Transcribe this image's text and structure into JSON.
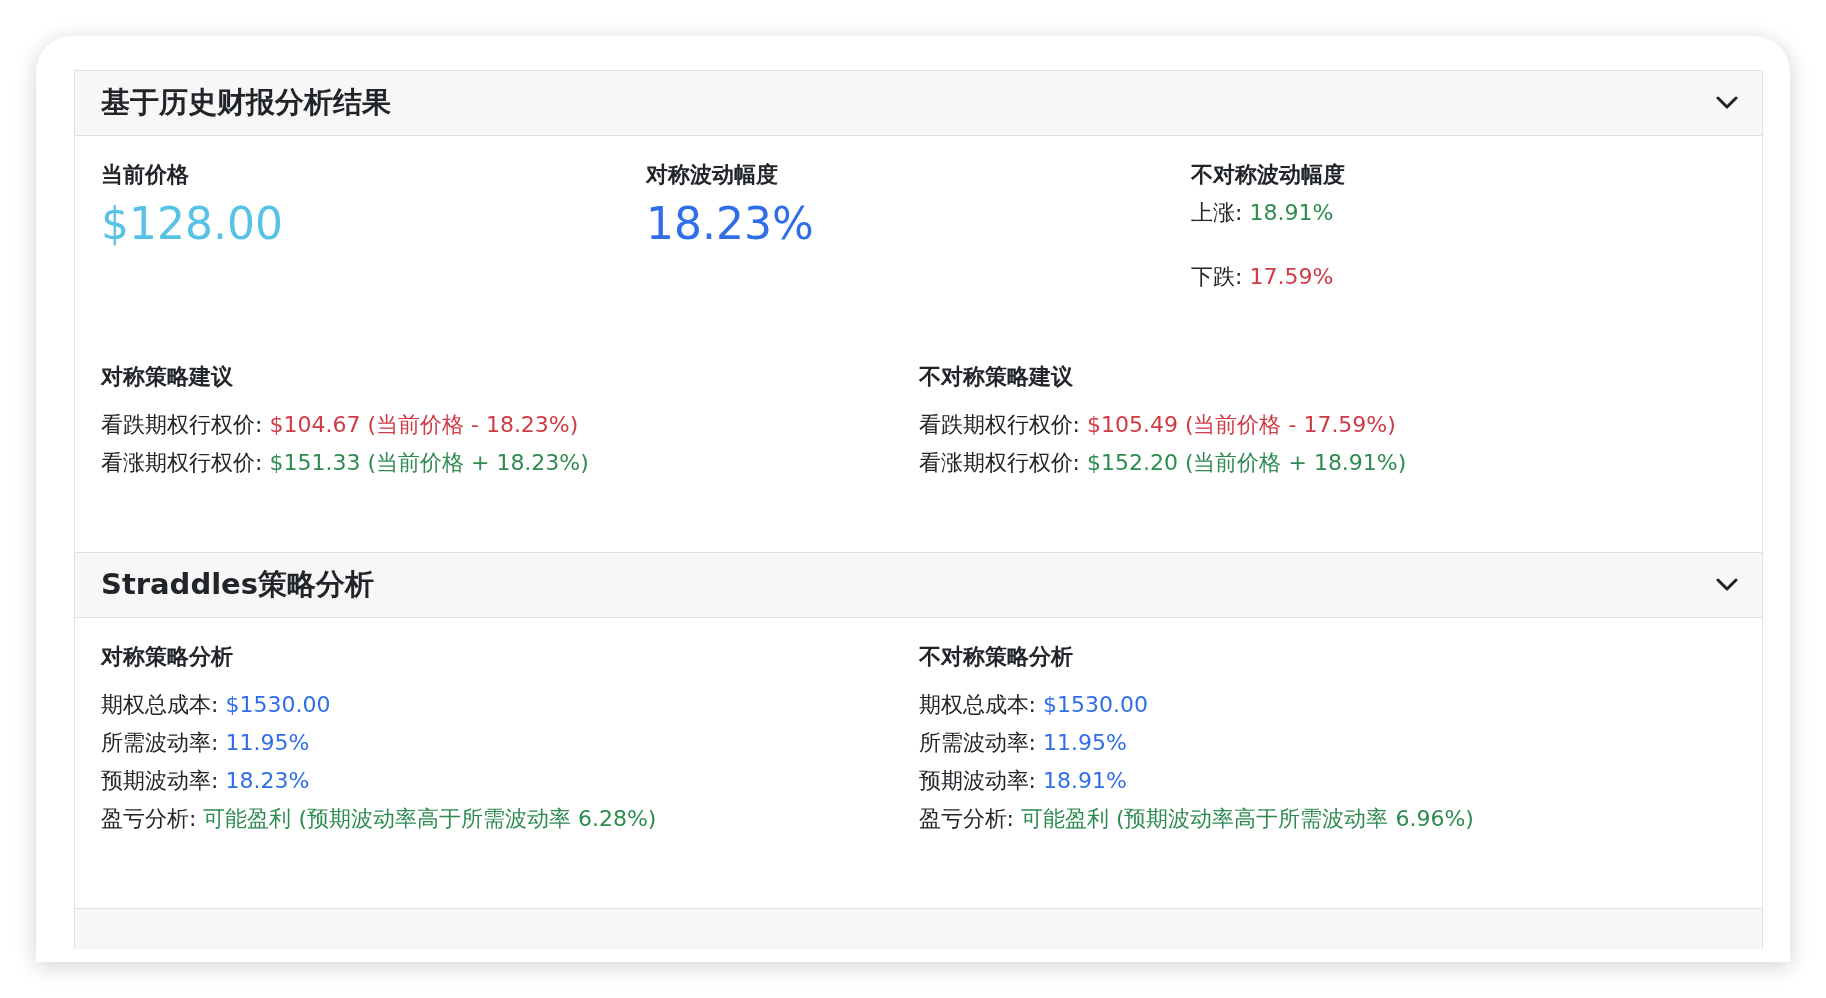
{
  "sections": [
    {
      "title": "基于历史财报分析结果",
      "expanded": true,
      "metrics": [
        {
          "label": "当前价格",
          "kind": "price",
          "value": "$128.00"
        },
        {
          "label": "对称波动幅度",
          "kind": "percent",
          "value": "18.23%"
        },
        {
          "label": "不对称波动幅度",
          "kind": "split",
          "lines": [
            {
              "label": "上涨:",
              "value": "18.91%",
              "kind": "up"
            },
            {
              "label": "下跌:",
              "value": "17.59%",
              "kind": "down"
            }
          ]
        }
      ],
      "columns": [
        {
          "heading": "对称策略建议",
          "lines": [
            {
              "label": "看跌期权行权价:",
              "value": "$104.67 (当前价格 - 18.23%)",
              "kind": "down"
            },
            {
              "label": "看涨期权行权价:",
              "value": "$151.33 (当前价格 + 18.23%)",
              "kind": "up"
            }
          ]
        },
        {
          "heading": "不对称策略建议",
          "lines": [
            {
              "label": "看跌期权行权价:",
              "value": "$105.49 (当前价格 - 17.59%)",
              "kind": "down"
            },
            {
              "label": "看涨期权行权价:",
              "value": "$152.20 (当前价格 + 18.91%)",
              "kind": "up"
            }
          ]
        }
      ]
    },
    {
      "title": "Straddles策略分析",
      "expanded": true,
      "columns": [
        {
          "heading": "对称策略分析",
          "lines": [
            {
              "label": "期权总成本:",
              "value": "$1530.00",
              "kind": "info"
            },
            {
              "label": "所需波动率:",
              "value": "11.95%",
              "kind": "info"
            },
            {
              "label": "预期波动率:",
              "value": "18.23%",
              "kind": "info"
            },
            {
              "label": "盈亏分析:",
              "value": "可能盈利 (预期波动率高于所需波动率 6.28%)",
              "kind": "up"
            }
          ]
        },
        {
          "heading": "不对称策略分析",
          "lines": [
            {
              "label": "期权总成本:",
              "value": "$1530.00",
              "kind": "info"
            },
            {
              "label": "所需波动率:",
              "value": "11.95%",
              "kind": "info"
            },
            {
              "label": "预期波动率:",
              "value": "18.91%",
              "kind": "info"
            },
            {
              "label": "盈亏分析:",
              "value": "可能盈利 (预期波动率高于所需波动率 6.96%)",
              "kind": "up"
            }
          ]
        }
      ]
    }
  ]
}
